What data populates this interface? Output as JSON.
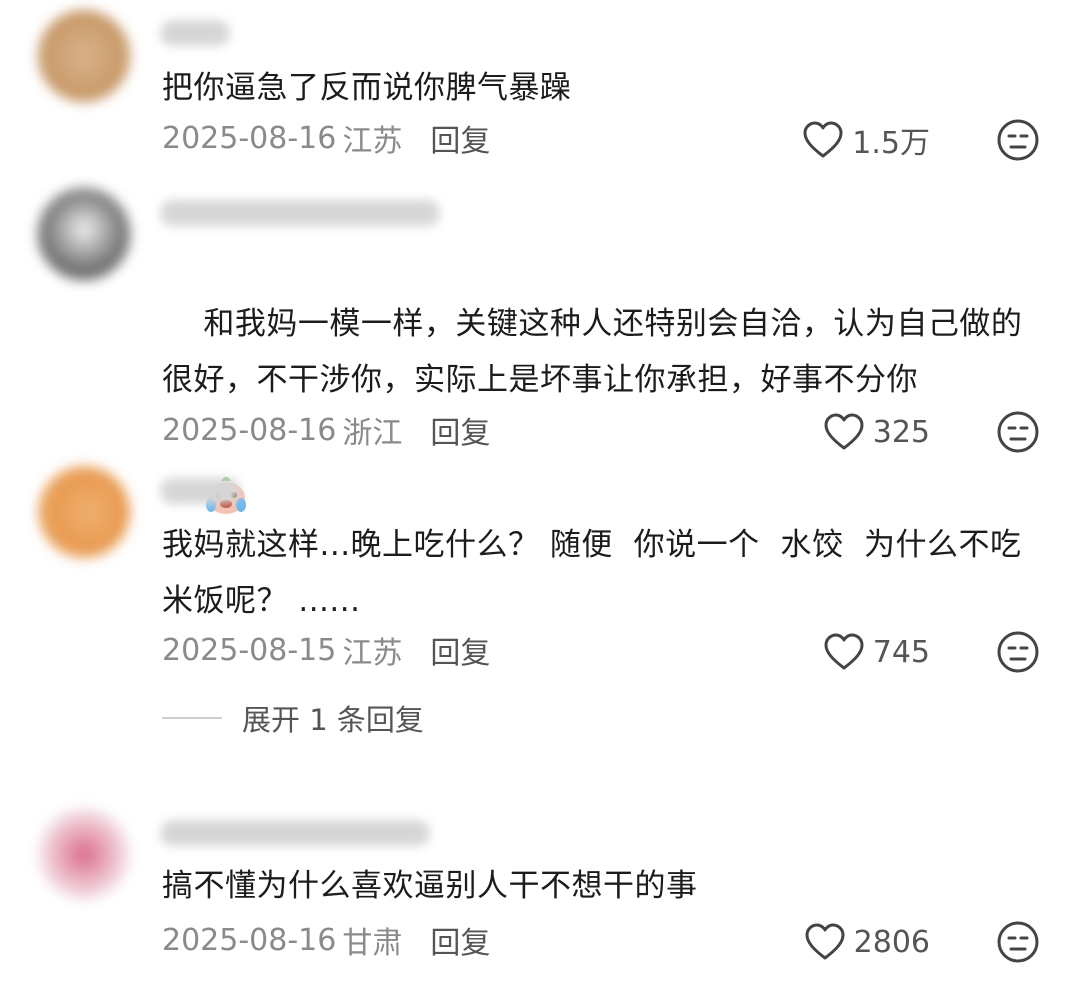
{
  "comments": [
    {
      "text": "把你逼急了反而说你脾气暴躁",
      "date": "2025-08-16",
      "location": "江苏",
      "reply_label": "回复",
      "likes": "1.5万"
    },
    {
      "text": "和我妈一模一样，关键这种人还特别会自洽，认为自己做的很好，不干涉你，实际上是坏事让你承担，好事不分你",
      "date": "2025-08-16",
      "location": "浙江",
      "reply_label": "回复",
      "likes": "325"
    },
    {
      "text": "我妈就这样...晚上吃什么？ 随便  你说一个  水饺  为什么不吃米饭呢？ ......",
      "date": "2025-08-15",
      "location": "江苏",
      "reply_label": "回复",
      "likes": "745"
    },
    {
      "text": "搞不懂为什么喜欢逼别人干不想干的事",
      "date": "2025-08-16",
      "location": "甘肃",
      "reply_label": "回复",
      "likes": "2806"
    }
  ],
  "expand_replies": {
    "label": "展开 1 条回复"
  },
  "icons": {
    "like": "heart-outline-icon",
    "dislike": "neutral-face-icon",
    "sticker": "crying-face-sticker-icon"
  },
  "colors": {
    "text": "#1c1c1c",
    "meta": "#8a8a8a",
    "action": "#555555"
  }
}
